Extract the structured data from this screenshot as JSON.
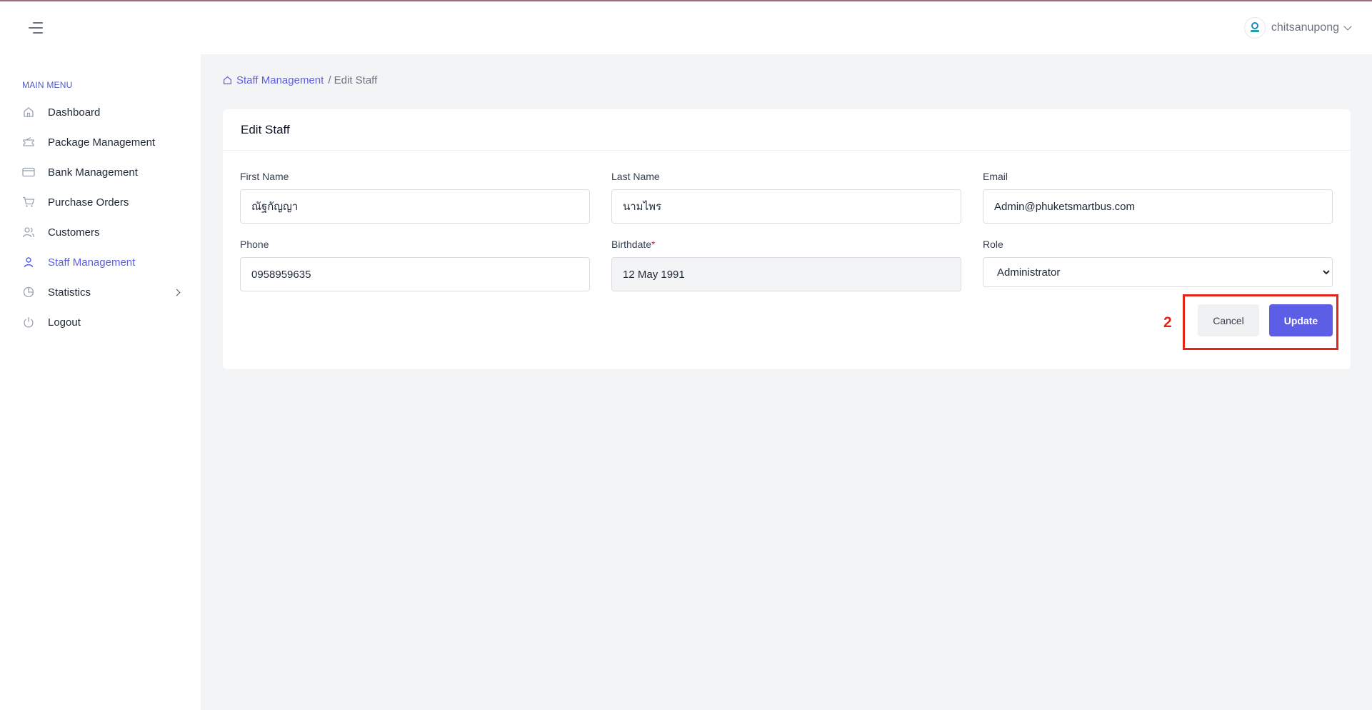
{
  "header": {
    "username": "chitsanupong"
  },
  "sidebar": {
    "heading": "MAIN MENU",
    "items": [
      {
        "label": "Dashboard",
        "icon": "home-icon"
      },
      {
        "label": "Package Management",
        "icon": "ticket-icon"
      },
      {
        "label": "Bank Management",
        "icon": "credit-card-icon"
      },
      {
        "label": "Purchase Orders",
        "icon": "cart-icon"
      },
      {
        "label": "Customers",
        "icon": "users-icon"
      },
      {
        "label": "Staff Management",
        "icon": "user-icon",
        "active": true
      },
      {
        "label": "Statistics",
        "icon": "pie-chart-icon"
      },
      {
        "label": "Logout",
        "icon": "power-icon"
      }
    ]
  },
  "breadcrumb": {
    "parent": "Staff Management",
    "current": "/ Edit Staff"
  },
  "form": {
    "title": "Edit Staff",
    "first_name_label": "First Name",
    "first_name_value": "ณัฐกัญญา",
    "last_name_label": "Last Name",
    "last_name_value": "นามไพร",
    "email_label": "Email",
    "email_value": "Admin@phuketsmartbus.com",
    "phone_label": "Phone",
    "phone_value": "0958959635",
    "birthdate_label": "Birthdate",
    "birthdate_required": "*",
    "birthdate_value": "12 May 1991",
    "role_label": "Role",
    "role_value": "Administrator",
    "cancel_label": "Cancel",
    "update_label": "Update"
  },
  "annotation": {
    "number": "2"
  },
  "colors": {
    "accent": "#5c5fe6",
    "annotation": "#e32416",
    "background": "#f3f4f6"
  }
}
